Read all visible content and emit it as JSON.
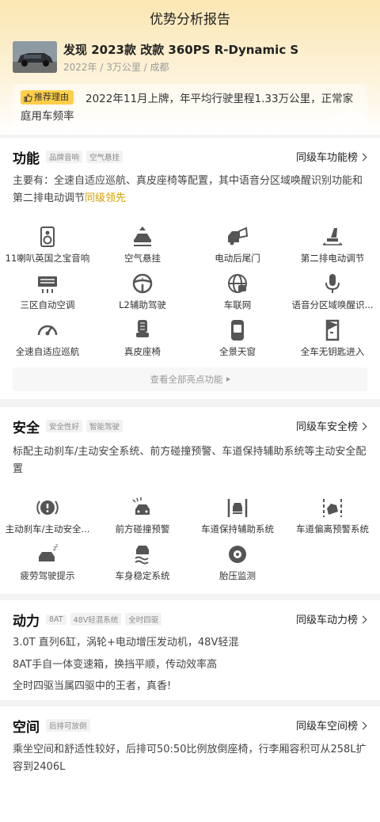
{
  "header": {
    "title": "优势分析报告"
  },
  "car": {
    "name": "发现 2023款 改款 360PS R-Dynamic S",
    "meta": "2022年 / 3万公里 / 成都"
  },
  "reason": {
    "tag": "推荐理由",
    "text": "2022年11月上牌，年平均行驶里程1.33万公里，正常家庭用车频率"
  },
  "features": {
    "title": "功能",
    "tags": [
      "品牌音响",
      "空气悬挂"
    ],
    "rank_label": "同级车功能榜",
    "desc_prefix": "主要有：全速自适应巡航、真皮座椅等配置，其中语音分区域唤醒识别功能和第二排电动调节",
    "desc_highlight": "同级领先",
    "items": [
      {
        "label": "11喇叭英国之宝音响",
        "icon": "speaker-icon"
      },
      {
        "label": "空气悬挂",
        "icon": "air-suspension-icon"
      },
      {
        "label": "电动后尾门",
        "icon": "power-tailgate-icon"
      },
      {
        "label": "第二排电动调节",
        "icon": "seat-adjust-icon"
      },
      {
        "label": "三区自动空调",
        "icon": "climate-control-icon"
      },
      {
        "label": "L2辅助驾驶",
        "icon": "steering-wheel-icon"
      },
      {
        "label": "车联网",
        "icon": "globe-icon"
      },
      {
        "label": "语音分区域唤醒识...",
        "icon": "microphone-icon"
      },
      {
        "label": "全速自适应巡航",
        "icon": "speedometer-icon"
      },
      {
        "label": "真皮座椅",
        "icon": "leather-seat-icon"
      },
      {
        "label": "全景天窗",
        "icon": "sunroof-icon"
      },
      {
        "label": "全车无钥匙进入",
        "icon": "keyless-entry-icon"
      }
    ],
    "view_all": "查看全部亮点功能"
  },
  "safety": {
    "title": "安全",
    "tags": [
      "安全性好",
      "智能驾驶"
    ],
    "rank_label": "同级车安全榜",
    "desc": "标配主动刹车/主动安全系统、前方碰撞预警、车道保持辅助系统等主动安全配置",
    "items": [
      {
        "label": "主动刹车/主动安全...",
        "icon": "brake-warning-icon"
      },
      {
        "label": "前方碰撞预警",
        "icon": "collision-warning-icon"
      },
      {
        "label": "车道保持辅助系统",
        "icon": "lane-keep-icon"
      },
      {
        "label": "车道偏离预警系统",
        "icon": "lane-departure-icon"
      },
      {
        "label": "疲劳驾驶提示",
        "icon": "fatigue-icon"
      },
      {
        "label": "车身稳定系统",
        "icon": "stability-icon"
      },
      {
        "label": "胎压监测",
        "icon": "tire-pressure-icon"
      }
    ]
  },
  "power": {
    "title": "动力",
    "tags": [
      "8AT",
      "48V轻混系统",
      "全时四驱"
    ],
    "rank_label": "同级车动力榜",
    "lines": [
      "3.0T 直列6缸，涡轮+电动增压发动机，48V轻混",
      "8AT手自一体变速箱，换挡平顺，传动效率高",
      "全时四驱当属四驱中的王者，真香!"
    ]
  },
  "space": {
    "title": "空间",
    "tags": [
      "后排可放倒"
    ],
    "rank_label": "同级车空间榜",
    "desc": "乘坐空间和舒适性较好，后排可50:50比例放倒座椅，行李厢容积可从258L扩容到2406L"
  },
  "colors": {
    "accent_yellow": "#ffcf48",
    "highlight": "#d4a000",
    "icon_gray": "#555555"
  }
}
